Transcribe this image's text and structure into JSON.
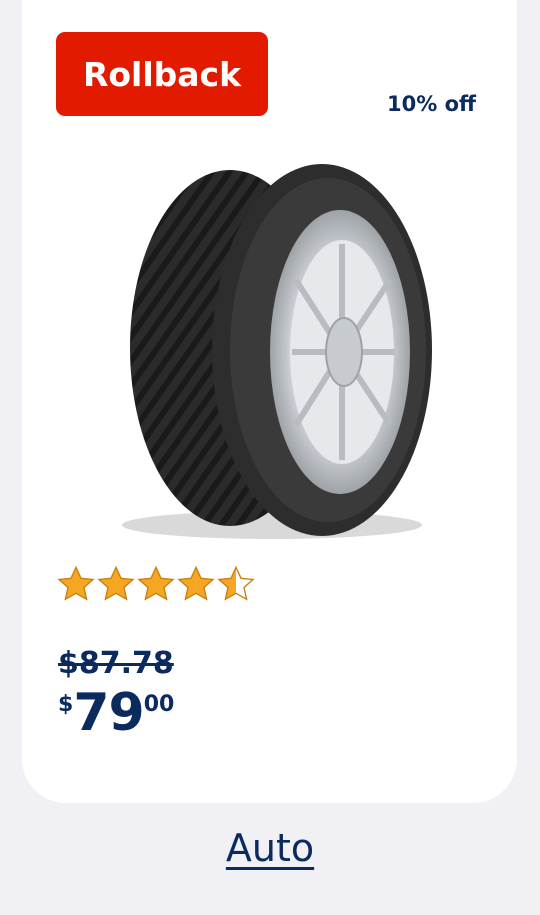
{
  "badge": {
    "label": "Rollback",
    "color": "#e21a00"
  },
  "discount": {
    "label": "10% off"
  },
  "product": {
    "image_icon": "tire-image",
    "rating": 4.5,
    "rating_max": 5
  },
  "price": {
    "was": "$87.78",
    "currency": "$",
    "dollars": "79",
    "cents": "00"
  },
  "category": {
    "label": "Auto"
  },
  "colors": {
    "accent": "#0b2a5e",
    "star": "#f5a623"
  }
}
